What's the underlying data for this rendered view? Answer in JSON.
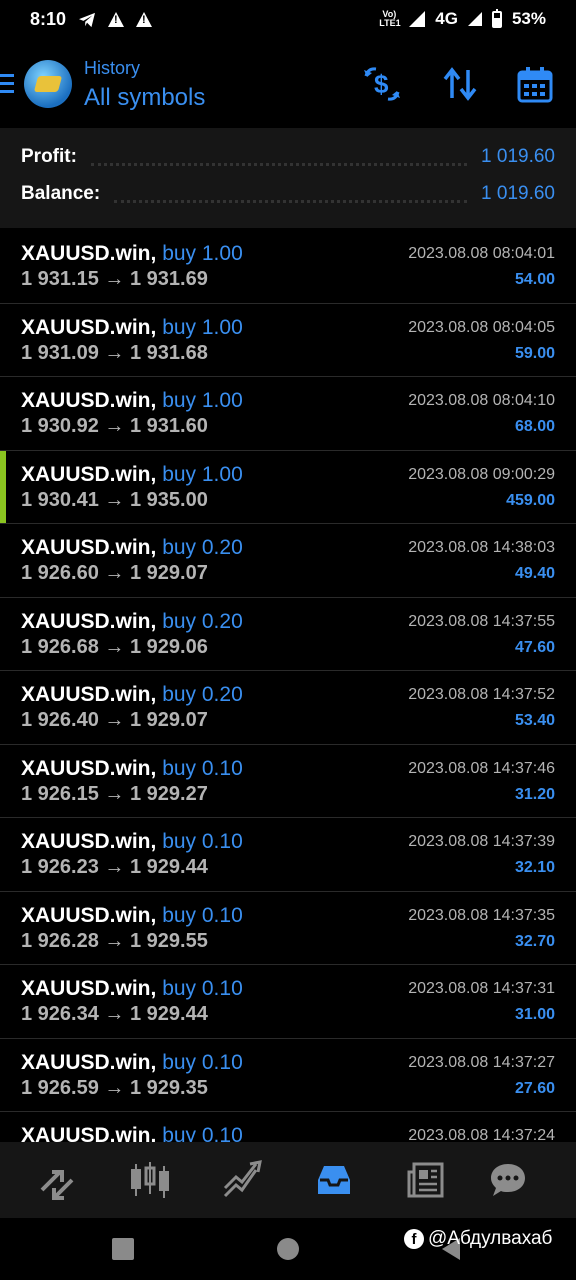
{
  "status": {
    "time": "8:10",
    "network": "4G",
    "battery": "53%",
    "volte_line1": "Vo)",
    "volte_line2": "LTE1"
  },
  "header": {
    "subtitle": "History",
    "title": "All symbols"
  },
  "summary": {
    "profit_label": "Profit:",
    "profit_value": "1 019.60",
    "balance_label": "Balance:",
    "balance_value": "1 019.60"
  },
  "deals": [
    {
      "symbol": "XAUUSD.win,",
      "type": "buy 1.00",
      "prices": "1 931.15 → 1 931.69",
      "time": "2023.08.08 08:04:01",
      "profit": "54.00"
    },
    {
      "symbol": "XAUUSD.win,",
      "type": "buy 1.00",
      "prices": "1 931.09 → 1 931.68",
      "time": "2023.08.08 08:04:05",
      "profit": "59.00"
    },
    {
      "symbol": "XAUUSD.win,",
      "type": "buy 1.00",
      "prices": "1 930.92 → 1 931.60",
      "time": "2023.08.08 08:04:10",
      "profit": "68.00"
    },
    {
      "symbol": "XAUUSD.win,",
      "type": "buy 1.00",
      "prices": "1 930.41 → 1 935.00",
      "time": "2023.08.08 09:00:29",
      "profit": "459.00"
    },
    {
      "symbol": "XAUUSD.win,",
      "type": "buy 0.20",
      "prices": "1 926.60 → 1 929.07",
      "time": "2023.08.08 14:38:03",
      "profit": "49.40"
    },
    {
      "symbol": "XAUUSD.win,",
      "type": "buy 0.20",
      "prices": "1 926.68 → 1 929.06",
      "time": "2023.08.08 14:37:55",
      "profit": "47.60"
    },
    {
      "symbol": "XAUUSD.win,",
      "type": "buy 0.20",
      "prices": "1 926.40 → 1 929.07",
      "time": "2023.08.08 14:37:52",
      "profit": "53.40"
    },
    {
      "symbol": "XAUUSD.win,",
      "type": "buy 0.10",
      "prices": "1 926.15 → 1 929.27",
      "time": "2023.08.08 14:37:46",
      "profit": "31.20"
    },
    {
      "symbol": "XAUUSD.win,",
      "type": "buy 0.10",
      "prices": "1 926.23 → 1 929.44",
      "time": "2023.08.08 14:37:39",
      "profit": "32.10"
    },
    {
      "symbol": "XAUUSD.win,",
      "type": "buy 0.10",
      "prices": "1 926.28 → 1 929.55",
      "time": "2023.08.08 14:37:35",
      "profit": "32.70"
    },
    {
      "symbol": "XAUUSD.win,",
      "type": "buy 0.10",
      "prices": "1 926.34 → 1 929.44",
      "time": "2023.08.08 14:37:31",
      "profit": "31.00"
    },
    {
      "symbol": "XAUUSD.win,",
      "type": "buy 0.10",
      "prices": "1 926.59 → 1 929.35",
      "time": "2023.08.08 14:37:27",
      "profit": "27.60"
    },
    {
      "symbol": "XAUUSD.win,",
      "type": "buy 0.10",
      "prices": "",
      "time": "2023.08.08 14:37:24",
      "profit": ""
    }
  ],
  "nav": {
    "items": [
      "quotes-icon",
      "chart-icon",
      "trade-icon",
      "history-icon",
      "news-icon",
      "chat-icon"
    ],
    "active_index": 3
  },
  "watermark": {
    "text": "@Абдулвахаб"
  },
  "colors": {
    "accent": "#3a8ff0",
    "marker": "#8ac420"
  }
}
